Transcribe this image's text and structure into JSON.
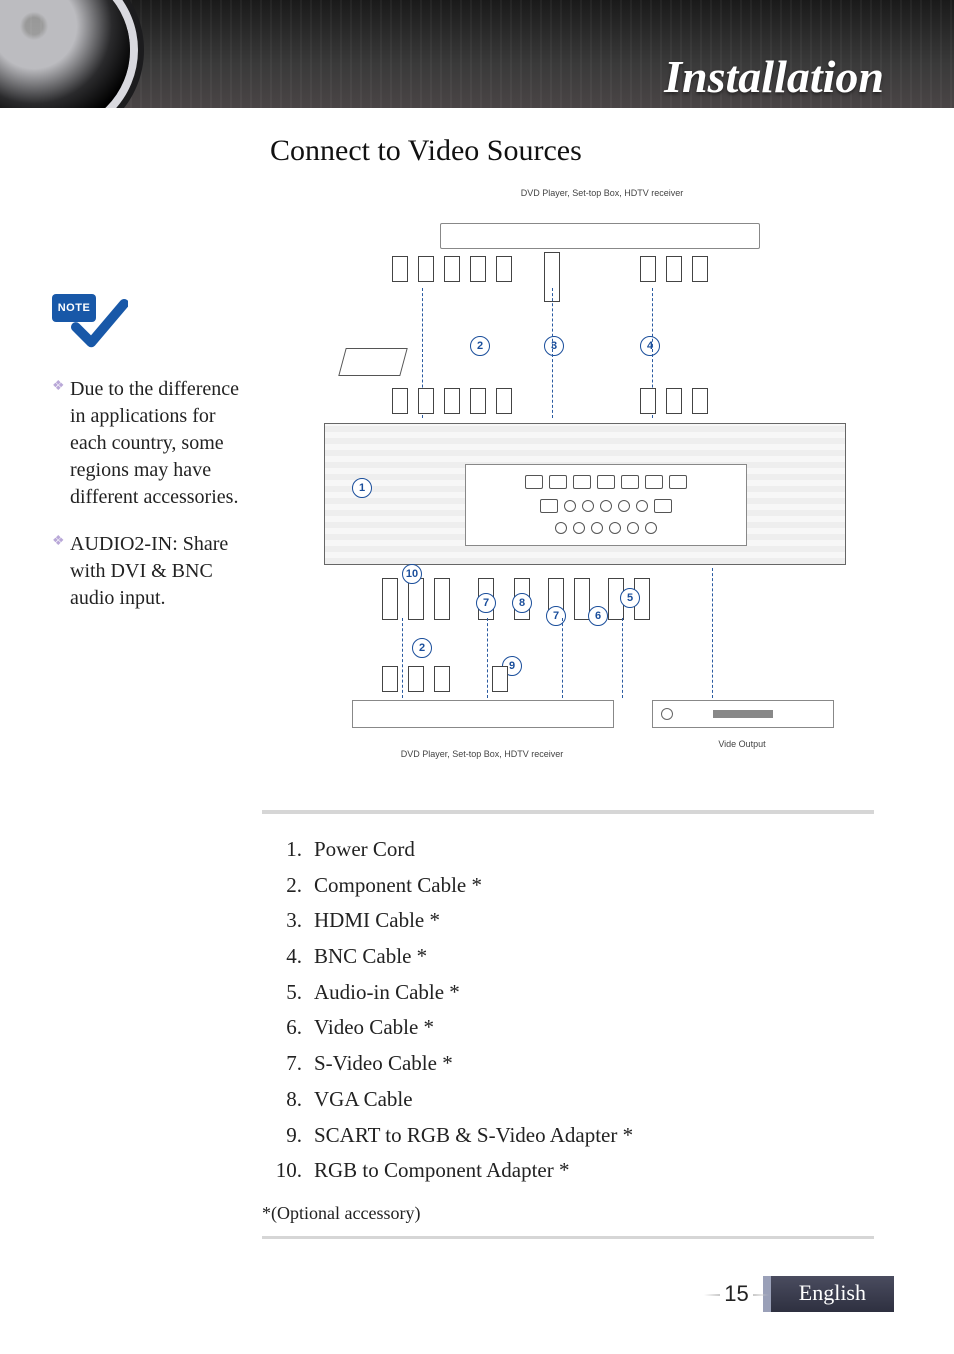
{
  "header": {
    "title": "Installation"
  },
  "section_title": "Connect to Video Sources",
  "note_badge_label": "NOTE",
  "sidebar_notes": [
    "Due to the difference in applications for each country, some regions may have different accessories.",
    "AUDIO2-IN: Share with DVI & BNC audio input."
  ],
  "diagram": {
    "top_device_label": "DVD Player, Set-top Box,\nHDTV receiver",
    "bottom_left_label": "DVD Player, Set-top Box,\nHDTV receiver",
    "bottom_right_label": "Vide Output",
    "adapter_label": "",
    "callouts": [
      "1",
      "2",
      "3",
      "4",
      "5",
      "6",
      "7",
      "8",
      "9",
      "10"
    ]
  },
  "cable_list": [
    "Power Cord",
    "Component Cable *",
    "HDMI Cable *",
    "BNC Cable *",
    "Audio-in Cable *",
    "Video Cable *",
    "S-Video Cable *",
    "VGA Cable",
    "SCART to RGB & S-Video Adapter *",
    "RGB to Component Adapter *"
  ],
  "optional_note": "*(Optional accessory)",
  "footer": {
    "page_number": "15",
    "language": "English"
  }
}
